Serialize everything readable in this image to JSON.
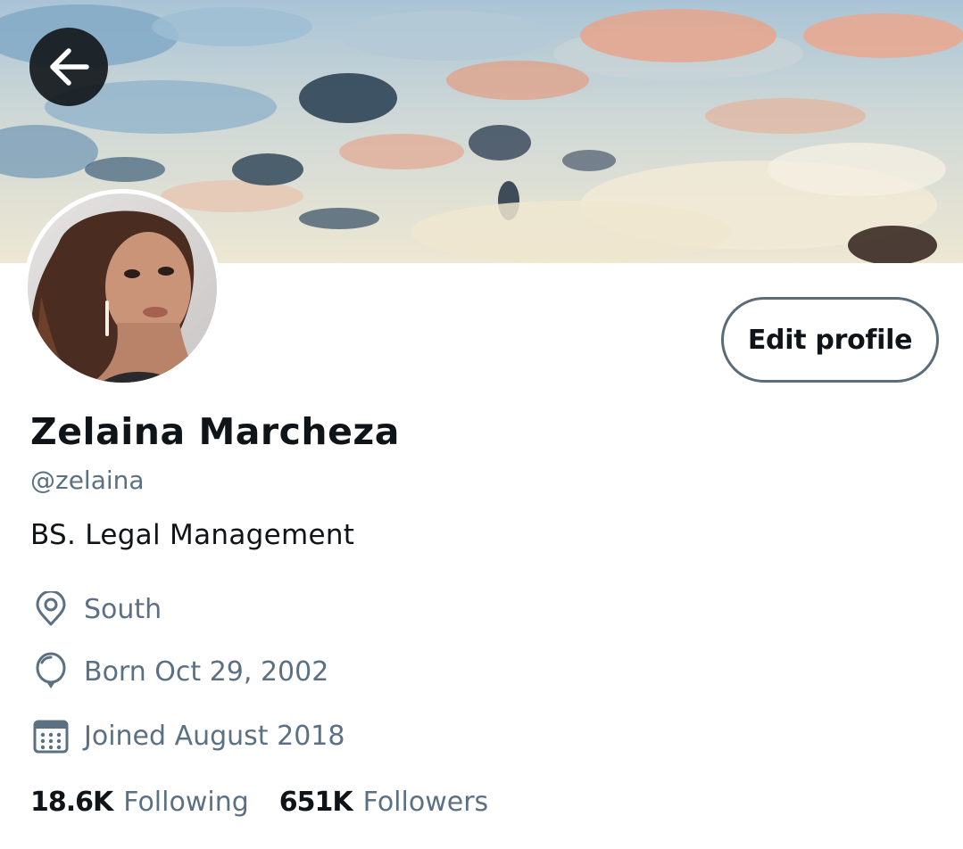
{
  "header": {
    "back_icon": "arrow-left-icon"
  },
  "profile": {
    "display_name": "Zelaina Marcheza",
    "handle": "@zelaina",
    "bio": "BS. Legal Management",
    "location": "South",
    "birthday": "Born Oct 29, 2002",
    "joined": "Joined August 2018"
  },
  "actions": {
    "edit_profile_label": "Edit profile"
  },
  "stats": {
    "following_count": "18.6K",
    "following_label": "Following",
    "followers_count": "651K",
    "followers_label": "Followers"
  },
  "icons": {
    "location": "location-pin-icon",
    "birthday": "balloon-icon",
    "joined": "calendar-icon"
  },
  "colors": {
    "text_primary": "#0f1419",
    "text_secondary": "#5b7083",
    "button_border": "#5b6b78",
    "back_button_bg": "#14181c"
  }
}
